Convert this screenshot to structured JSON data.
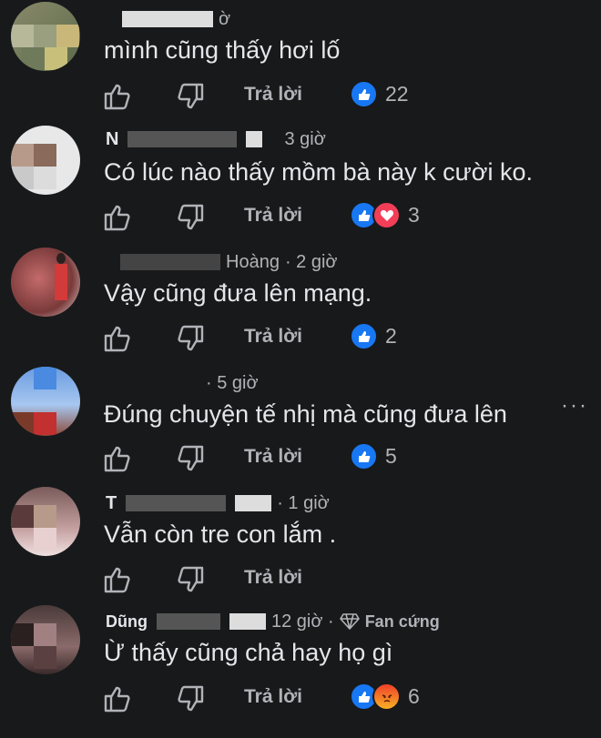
{
  "labels": {
    "reply": "Trả lời"
  },
  "comments": [
    {
      "name": "",
      "time": "ờ",
      "badge": "",
      "text": "mình cũng thấy hơi lố",
      "reaction_count": "22",
      "reactions": [
        "like"
      ]
    },
    {
      "name": "N",
      "time": "3 giờ",
      "badge": "",
      "text": "Có lúc nào thấy mồm bà này k cười ko.",
      "reaction_count": "3",
      "reactions": [
        "like",
        "love"
      ]
    },
    {
      "name": "Hoàng",
      "time": "· 2 giờ",
      "badge": "",
      "text": "Vậy cũng đưa lên mạng.",
      "reaction_count": "2",
      "reactions": [
        "like"
      ]
    },
    {
      "name": "",
      "time": "· 5 giờ",
      "badge": "",
      "text": "Đúng chuyện tế nhị mà cũng đưa lên",
      "reaction_count": "5",
      "reactions": [
        "like"
      ]
    },
    {
      "name": "T",
      "time": "· 1 giờ",
      "badge": "",
      "text": "Vẫn còn tre con lắm .",
      "reaction_count": "",
      "reactions": []
    },
    {
      "name": "Dũng",
      "time": "12 giờ ·",
      "badge": "Fan cứng",
      "text": "Ừ thấy cũng chả hay họ gì",
      "reaction_count": "6",
      "reactions": [
        "like",
        "angry"
      ]
    }
  ],
  "more_menu": "···",
  "colors": {
    "background": "#18191a",
    "text": "#e4e6eb",
    "secondary": "#b0b3b8",
    "like": "#1877f2",
    "love": "#f33e58",
    "angry": "#e9710f"
  }
}
